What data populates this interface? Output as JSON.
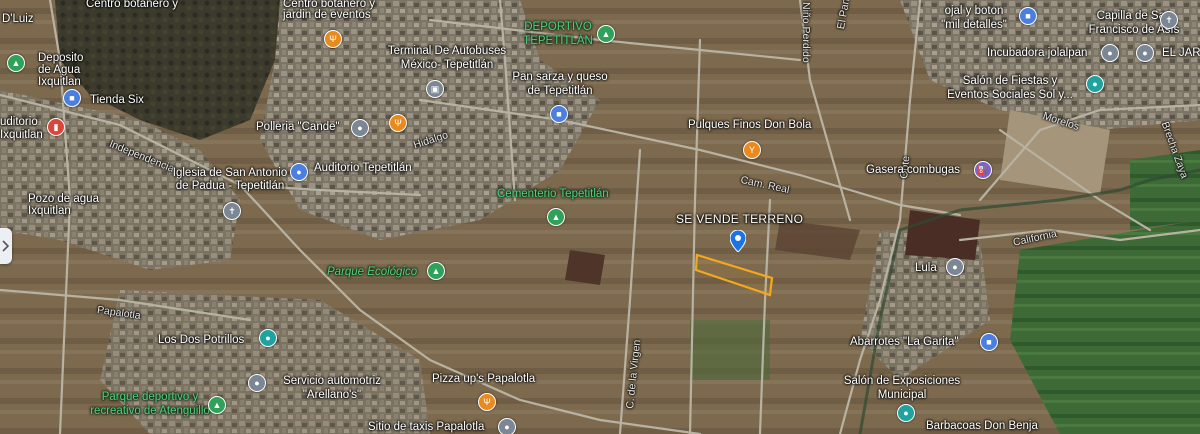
{
  "map": {
    "highlight_color": "#f4a81c",
    "labels": [
      {
        "id": "centro-botanero",
        "text": "Centro botanero y",
        "style": "white"
      },
      {
        "id": "jardin-eventos",
        "text": "jardin de eventos",
        "style": "white"
      },
      {
        "id": "dluiz",
        "text": "D'Luiz",
        "style": "white"
      },
      {
        "id": "deposito-agua",
        "text": "Deposito\nde Agua\nIxquitlan",
        "style": "white"
      },
      {
        "id": "tienda-six",
        "text": "Tienda Six",
        "style": "white"
      },
      {
        "id": "auditorio",
        "text": "uditorio\nIxquitlan",
        "style": "white"
      },
      {
        "id": "independencia",
        "text": "Independencia",
        "style": "road"
      },
      {
        "id": "polleria",
        "text": "Polleria \"Cande\"",
        "style": "white"
      },
      {
        "id": "terminal",
        "text": "Terminal De Autobuses\nMéxico- Tepetitlán",
        "style": "white"
      },
      {
        "id": "deportivo",
        "text": "DEPORTIVO\nTEPETITLÁN",
        "style": "green"
      },
      {
        "id": "pan-sarza",
        "text": "Pan sarza y queso\nde Tepetitlán",
        "style": "white"
      },
      {
        "id": "nino-perdido",
        "text": "Niño Perdido",
        "style": "road"
      },
      {
        "id": "el-panteon",
        "text": "El Panteón",
        "style": "road"
      },
      {
        "id": "pulques",
        "text": "Pulques Finos Don Bola",
        "style": "white"
      },
      {
        "id": "hidalgo",
        "text": "Hidalgo",
        "style": "road"
      },
      {
        "id": "iglesia",
        "text": "Iglesia de San Antonio\nde Padua - Tepetitlán",
        "style": "white"
      },
      {
        "id": "auditorio-tepe",
        "text": "Auditorio Tepetitlán",
        "style": "white"
      },
      {
        "id": "cam-real",
        "text": "Cam. Real",
        "style": "road"
      },
      {
        "id": "cementerio",
        "text": "Cementerio Tepetitlán",
        "style": "green"
      },
      {
        "id": "pozo",
        "text": "Pozo de agua\nIxquitlan",
        "style": "white"
      },
      {
        "id": "se-vende",
        "text": "SE VENDE TERRENO",
        "style": "big"
      },
      {
        "id": "parque-eco",
        "text": "Parque Ecológico",
        "style": "green"
      },
      {
        "id": "papalotla",
        "text": "Papalotla",
        "style": "road"
      },
      {
        "id": "los-dos-potrillos",
        "text": "Los Dos Potrillos",
        "style": "white"
      },
      {
        "id": "servicio",
        "text": "Servicio automotriz\n\"Arellano's\"",
        "style": "white"
      },
      {
        "id": "pizza",
        "text": "Pizza up's Papalotla",
        "style": "white"
      },
      {
        "id": "parque-deportivo",
        "text": "Parque deportivo y\nrecreativo de Atenguillo",
        "style": "green"
      },
      {
        "id": "sitio-taxis",
        "text": "Sitio de taxis Papalotla",
        "style": "white"
      },
      {
        "id": "c-virgen",
        "text": "C. de la Virgen",
        "style": "road"
      },
      {
        "id": "oote",
        "text": "Oote",
        "style": "road"
      },
      {
        "id": "ojal",
        "text": "ojal y boton\n\"mil detalles\"",
        "style": "white"
      },
      {
        "id": "capilla",
        "text": "Capilla de San\nFrancisco de Asís",
        "style": "white"
      },
      {
        "id": "incubadora",
        "text": "Incubadora jolalpan",
        "style": "white"
      },
      {
        "id": "el-jar",
        "text": "EL JAR",
        "style": "white"
      },
      {
        "id": "salon-fiestas",
        "text": "Salón de Fiestas y\nEventos Sociales Sol y...",
        "style": "white"
      },
      {
        "id": "morelos",
        "text": "Morelos",
        "style": "road"
      },
      {
        "id": "brecha",
        "text": "Brecha Zaya",
        "style": "road"
      },
      {
        "id": "gasera",
        "text": "Gasera combugas",
        "style": "white"
      },
      {
        "id": "california",
        "text": "California",
        "style": "road"
      },
      {
        "id": "lula",
        "text": "Lula",
        "style": "white"
      },
      {
        "id": "abarrotes",
        "text": "Abarrotes \"La Garita\"",
        "style": "white"
      },
      {
        "id": "salon-expo",
        "text": "Salón de Exposiciones\nMunicipal",
        "style": "white"
      },
      {
        "id": "barbacoas",
        "text": "Barbacoas Don Benja",
        "style": "white"
      }
    ],
    "pins": [
      {
        "id": "pin-deposito",
        "icon": "tree-icon",
        "color": "green"
      },
      {
        "id": "pin-tienda",
        "icon": "shopping-bag-icon",
        "color": "blue"
      },
      {
        "id": "pin-auditorio-ix",
        "icon": "building-icon",
        "color": "red"
      },
      {
        "id": "pin-centro",
        "icon": "fork-knife-icon",
        "color": "orange"
      },
      {
        "id": "pin-polleria-1",
        "icon": "place-icon",
        "color": "gray"
      },
      {
        "id": "pin-polleria-2",
        "icon": "fork-knife-icon",
        "color": "orange"
      },
      {
        "id": "pin-terminal",
        "icon": "bus-icon",
        "color": "gray"
      },
      {
        "id": "pin-deportivo",
        "icon": "tree-icon",
        "color": "green"
      },
      {
        "id": "pin-pan",
        "icon": "shopping-bag-icon",
        "color": "blue"
      },
      {
        "id": "pin-pulques",
        "icon": "drink-icon",
        "color": "orange"
      },
      {
        "id": "pin-auditorio-tepe",
        "icon": "place-icon",
        "color": "blue"
      },
      {
        "id": "pin-iglesia",
        "icon": "church-icon",
        "color": "gray"
      },
      {
        "id": "pin-cementerio",
        "icon": "tree-icon",
        "color": "green"
      },
      {
        "id": "pin-parque-eco",
        "icon": "tree-icon",
        "color": "green"
      },
      {
        "id": "pin-potrillos",
        "icon": "place-icon",
        "color": "teal"
      },
      {
        "id": "pin-servicio",
        "icon": "place-icon",
        "color": "gray"
      },
      {
        "id": "pin-pizza",
        "icon": "fork-knife-icon",
        "color": "orange"
      },
      {
        "id": "pin-parque-dep",
        "icon": "tree-icon",
        "color": "green"
      },
      {
        "id": "pin-taxis",
        "icon": "place-icon",
        "color": "gray"
      },
      {
        "id": "pin-ojal",
        "icon": "shopping-bag-icon",
        "color": "blue"
      },
      {
        "id": "pin-capilla",
        "icon": "church-icon",
        "color": "gray"
      },
      {
        "id": "pin-incubadora",
        "icon": "place-icon",
        "color": "gray"
      },
      {
        "id": "pin-eljar",
        "icon": "place-icon",
        "color": "gray"
      },
      {
        "id": "pin-salon",
        "icon": "place-icon",
        "color": "teal"
      },
      {
        "id": "pin-gasera",
        "icon": "gas-icon",
        "color": "purple"
      },
      {
        "id": "pin-lula",
        "icon": "place-icon",
        "color": "gray"
      },
      {
        "id": "pin-abarrotes",
        "icon": "shopping-bag-icon",
        "color": "blue"
      },
      {
        "id": "pin-expo",
        "icon": "place-icon",
        "color": "teal"
      },
      {
        "id": "pin-sevende",
        "icon": "location-marker-icon",
        "color": "blue"
      }
    ]
  }
}
